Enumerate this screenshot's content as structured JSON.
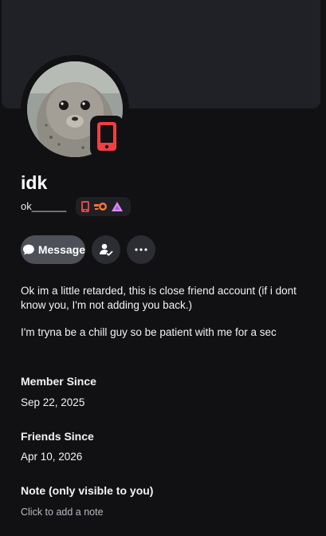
{
  "profile": {
    "display_name": "idk",
    "username": "ok______",
    "status": "Online on Mobile"
  },
  "actions": {
    "message_label": "Message"
  },
  "bio": {
    "line1": "Ok im a little retarded, this is close friend account (if i dont know you, I'm not adding you back.)",
    "line2": "I'm tryna be a chill guy so be patient with me for a sec"
  },
  "sections": {
    "member_since_title": "Member Since",
    "member_since_value": "Sep 22, 2025",
    "friends_since_title": "Friends Since",
    "friends_since_value": "Apr 10, 2026",
    "note_title": "Note (only visible to you)",
    "note_placeholder": "Click to add a note"
  },
  "colors": {
    "background": "#111114",
    "banner": "#202127",
    "mobile_status": "#f23f43",
    "message_button": "#4e5058"
  },
  "icons": [
    "mobile-status-icon",
    "mobile-badge-icon",
    "quest-badge-icon",
    "nitro-badge-icon",
    "chat-bubble-icon",
    "add-friend-icon",
    "more-icon"
  ]
}
